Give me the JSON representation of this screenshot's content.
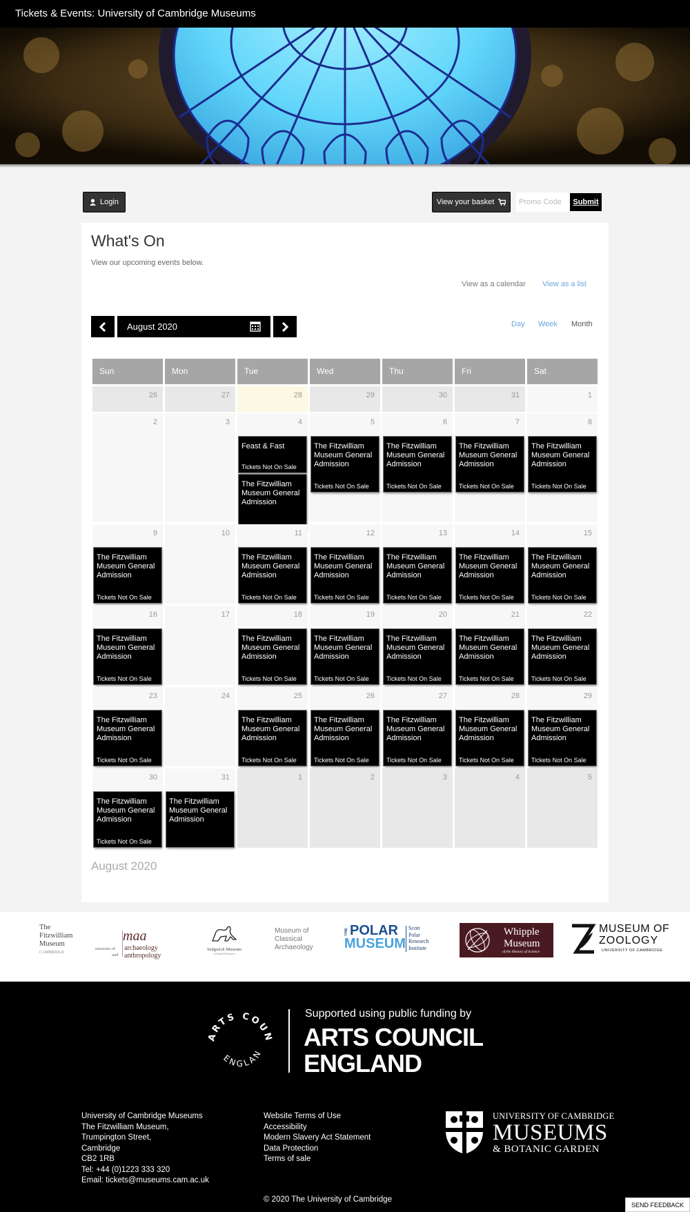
{
  "header": {
    "title": "Tickets & Events: University of Cambridge Museums"
  },
  "toolbar": {
    "login_label": "Login",
    "basket_label": "View your basket",
    "promo_placeholder": "Promo Code",
    "submit_label": "Submit"
  },
  "page": {
    "title": "What's On",
    "subtitle": "View our upcoming events below.",
    "view_calendar": "View as a calendar",
    "view_list": "View as a list"
  },
  "calendar_nav": {
    "month_label": "August 2020",
    "modes": [
      "Day",
      "Week",
      "Month"
    ],
    "active_mode": "Month"
  },
  "calendar": {
    "weekdays": [
      "Sun",
      "Mon",
      "Tue",
      "Wed",
      "Thu",
      "Fri",
      "Sat"
    ],
    "weeks": [
      [
        {
          "day": "26",
          "other": true,
          "events": []
        },
        {
          "day": "27",
          "other": true,
          "events": []
        },
        {
          "day": "28",
          "other": true,
          "today": true,
          "events": []
        },
        {
          "day": "29",
          "other": true,
          "events": []
        },
        {
          "day": "30",
          "other": true,
          "events": []
        },
        {
          "day": "31",
          "other": true,
          "events": []
        },
        {
          "day": "1",
          "events": []
        }
      ],
      [
        {
          "day": "2",
          "events": []
        },
        {
          "day": "3",
          "events": []
        },
        {
          "day": "4",
          "events": [
            {
              "name": "Feast & Fast",
              "status": "Tickets Not On Sale"
            },
            {
              "name": "The Fitzwilliam Museum General Admission",
              "status": ""
            }
          ]
        },
        {
          "day": "5",
          "events": [
            {
              "name": "The Fitzwilliam Museum General Admission",
              "status": "Tickets Not On Sale"
            }
          ]
        },
        {
          "day": "6",
          "events": [
            {
              "name": "The Fitzwilliam Museum General Admission",
              "status": "Tickets Not On Sale"
            }
          ]
        },
        {
          "day": "7",
          "events": [
            {
              "name": "The Fitzwilliam Museum General Admission",
              "status": "Tickets Not On Sale"
            }
          ]
        },
        {
          "day": "8",
          "events": [
            {
              "name": "The Fitzwilliam Museum General Admission",
              "status": "Tickets Not On Sale"
            }
          ]
        }
      ],
      [
        {
          "day": "9",
          "events": [
            {
              "name": "The Fitzwilliam Museum General Admission",
              "status": "Tickets Not On Sale"
            }
          ]
        },
        {
          "day": "10",
          "events": []
        },
        {
          "day": "11",
          "events": [
            {
              "name": "The Fitzwilliam Museum General Admission",
              "status": "Tickets Not On Sale"
            }
          ]
        },
        {
          "day": "12",
          "events": [
            {
              "name": "The Fitzwilliam Museum General Admission",
              "status": "Tickets Not On Sale"
            }
          ]
        },
        {
          "day": "13",
          "events": [
            {
              "name": "The Fitzwilliam Museum General Admission",
              "status": "Tickets Not On Sale"
            }
          ]
        },
        {
          "day": "14",
          "events": [
            {
              "name": "The Fitzwilliam Museum General Admission",
              "status": "Tickets Not On Sale"
            }
          ]
        },
        {
          "day": "15",
          "events": [
            {
              "name": "The Fitzwilliam Museum General Admission",
              "status": "Tickets Not On Sale"
            }
          ]
        }
      ],
      [
        {
          "day": "16",
          "events": [
            {
              "name": "The Fitzwilliam Museum General Admission",
              "status": "Tickets Not On Sale"
            }
          ]
        },
        {
          "day": "17",
          "events": []
        },
        {
          "day": "18",
          "events": [
            {
              "name": "The Fitzwilliam Museum General Admission",
              "status": "Tickets Not On Sale"
            }
          ]
        },
        {
          "day": "19",
          "events": [
            {
              "name": "The Fitzwilliam Museum General Admission",
              "status": "Tickets Not On Sale"
            }
          ]
        },
        {
          "day": "20",
          "events": [
            {
              "name": "The Fitzwilliam Museum General Admission",
              "status": "Tickets Not On Sale"
            }
          ]
        },
        {
          "day": "21",
          "events": [
            {
              "name": "The Fitzwilliam Museum General Admission",
              "status": "Tickets Not On Sale"
            }
          ]
        },
        {
          "day": "22",
          "events": [
            {
              "name": "The Fitzwilliam Museum General Admission",
              "status": "Tickets Not On Sale"
            }
          ]
        }
      ],
      [
        {
          "day": "23",
          "events": [
            {
              "name": "The Fitzwilliam Museum General Admission",
              "status": "Tickets Not On Sale"
            }
          ]
        },
        {
          "day": "24",
          "events": []
        },
        {
          "day": "25",
          "events": [
            {
              "name": "The Fitzwilliam Museum General Admission",
              "status": "Tickets Not On Sale"
            }
          ]
        },
        {
          "day": "26",
          "events": [
            {
              "name": "The Fitzwilliam Museum General Admission",
              "status": "Tickets Not On Sale"
            }
          ]
        },
        {
          "day": "27",
          "events": [
            {
              "name": "The Fitzwilliam Museum General Admission",
              "status": "Tickets Not On Sale"
            }
          ]
        },
        {
          "day": "28",
          "events": [
            {
              "name": "The Fitzwilliam Museum General Admission",
              "status": "Tickets Not On Sale"
            }
          ]
        },
        {
          "day": "29",
          "events": [
            {
              "name": "The Fitzwilliam Museum General Admission",
              "status": "Tickets Not On Sale"
            }
          ]
        }
      ],
      [
        {
          "day": "30",
          "events": [
            {
              "name": "The Fitzwilliam Museum General Admission",
              "status": "Tickets Not On Sale"
            }
          ]
        },
        {
          "day": "31",
          "events": [
            {
              "name": "The Fitzwilliam Museum General Admission",
              "status": ""
            }
          ]
        },
        {
          "day": "1",
          "other": true,
          "events": []
        },
        {
          "day": "2",
          "other": true,
          "events": []
        },
        {
          "day": "3",
          "other": true,
          "events": []
        },
        {
          "day": "4",
          "other": true,
          "events": []
        },
        {
          "day": "5",
          "other": true,
          "events": []
        }
      ]
    ],
    "footer_month": "August 2020"
  },
  "partners": {
    "fitzwilliam": [
      "The",
      "Fitzwilliam",
      "Museum",
      "CAMBRIDGE"
    ],
    "maa_mark": "maa",
    "maa_lines": [
      "museum of",
      "archaeology",
      "and",
      "anthropology"
    ],
    "sedgwick": [
      "Sedgwick Museum",
      "of Earth Sciences"
    ],
    "classical": [
      "Museum of",
      "Classical",
      "Archaeology"
    ],
    "polar_the": "THE",
    "polar_title": [
      "POLAR",
      "MUSEUM"
    ],
    "polar_sub": [
      "Scott",
      "Polar",
      "Research",
      "Institute"
    ],
    "whipple": [
      "Whipple",
      "Museum",
      "of the History of Science"
    ],
    "zoology": [
      "MUSEUM OF",
      "ZOOLOGY",
      "UNIVERSITY OF CAMBRIDGE"
    ]
  },
  "funding": {
    "circle_top": "ARTS COUNCIL",
    "circle_bottom": "ENGLAND",
    "supported": "Supported using public funding by",
    "name_line1": "ARTS COUNCIL",
    "name_line2": "ENGLAND"
  },
  "footer": {
    "address": [
      "University of Cambridge Museums",
      "The Fitzwilliam Museum,",
      "Trumpington Street,",
      "Cambridge",
      "CB2 1RB",
      "Tel: +44 (0)1223 333 320",
      "Email: tickets@museums.cam.ac.uk"
    ],
    "links": [
      "Website Terms of Use",
      "Accessibility",
      "Modern Slavery Act Statement",
      "Data Protection",
      "Terms of sale"
    ],
    "uc_line1": "UNIVERSITY OF CAMBRIDGE",
    "uc_line2": "MUSEUMS",
    "uc_line3": "& BOTANIC GARDEN",
    "copyright": "© 2020 The University of Cambridge",
    "feedback": "SEND FEEDBACK"
  },
  "colors": {
    "link": "#6aa6e0",
    "header_bg": "#a6a6a6",
    "today_bg": "#fcf8e3",
    "event_bg": "#000000"
  }
}
